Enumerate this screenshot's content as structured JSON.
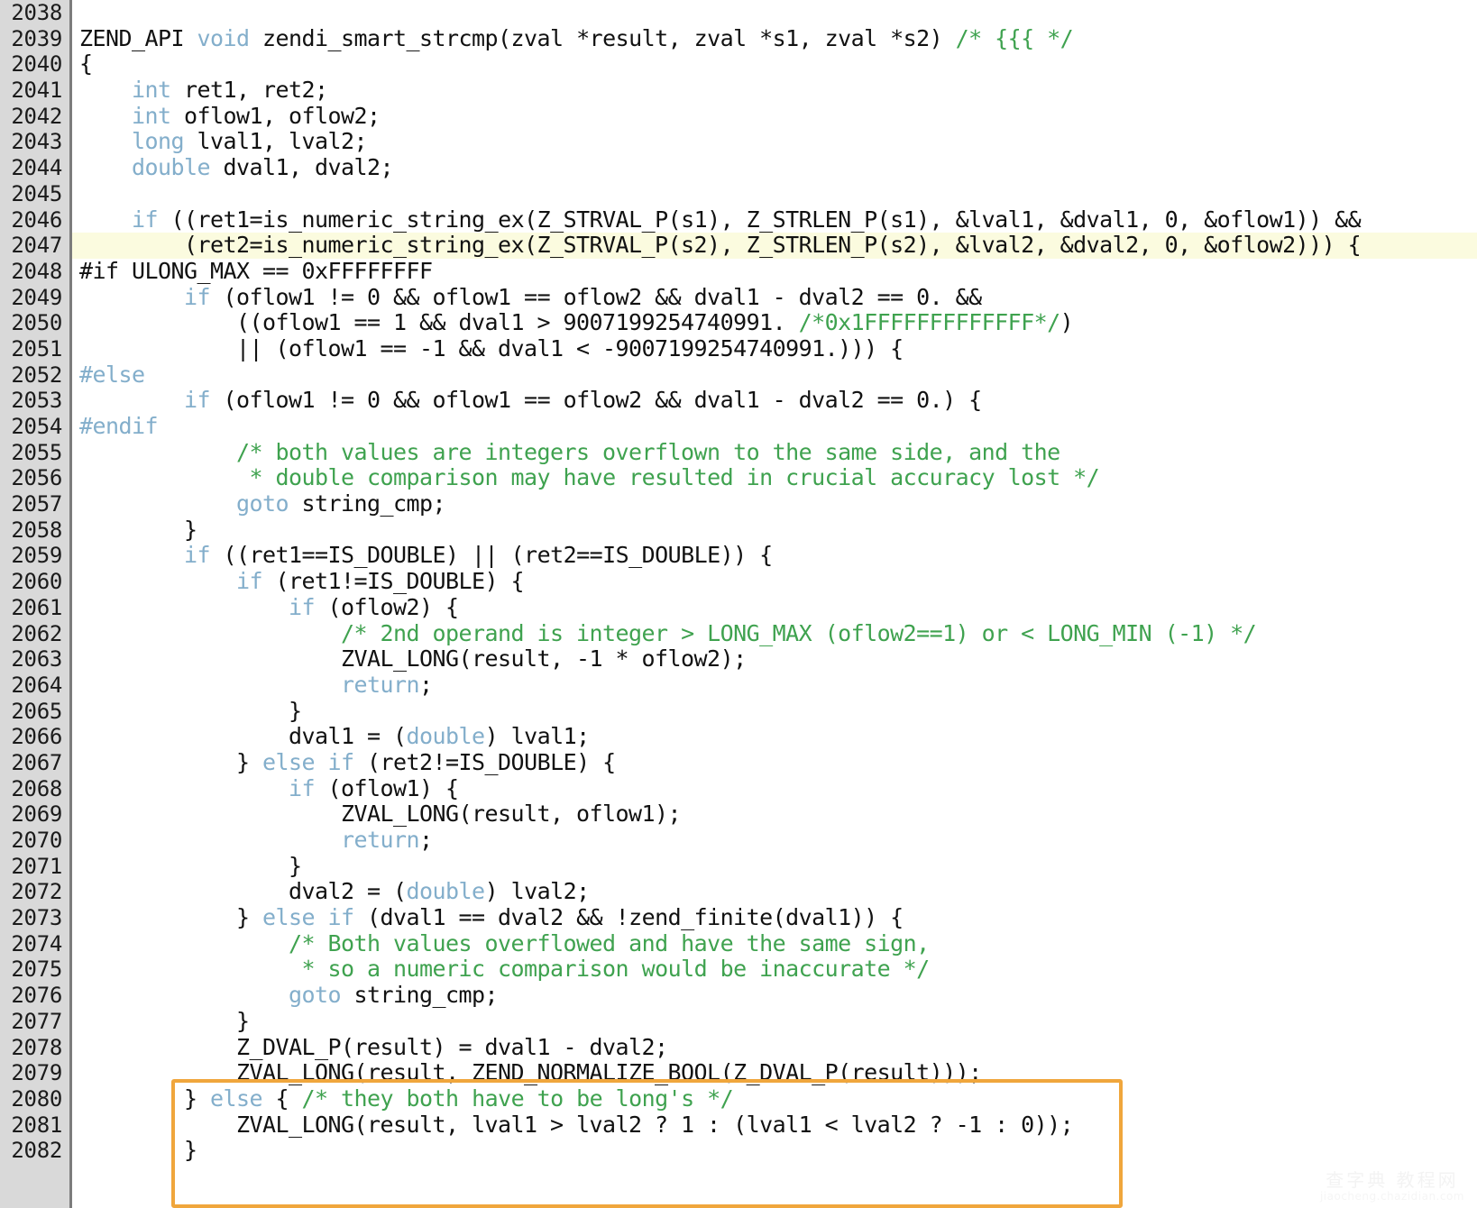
{
  "editor": {
    "title": "zendi_smart_strcmp source listing",
    "language": "C",
    "gutter_start_line": 2038,
    "gutter_end_line": 2082,
    "colors": {
      "background": "#ffffff",
      "gutter": "#d9d9d9",
      "gutter_border": "#7c7c7c",
      "text": "#111111",
      "keyword": "#83aecb",
      "comment": "#3fa24f",
      "highlight_line": "#fbfbdf",
      "callout_box": "#f0a63c"
    },
    "highlighted_line": 2047,
    "callout_box_lines": [
      2080,
      2082
    ]
  },
  "watermark": {
    "main": "查字典 教程网",
    "sub": "jiaocheng.chazidian.com"
  },
  "lines": [
    {
      "n": "2038",
      "hl": false,
      "tokens": []
    },
    {
      "n": "2039",
      "hl": false,
      "tokens": [
        {
          "t": "ZEND_API ",
          "c": "plain"
        },
        {
          "t": "void",
          "c": "kw"
        },
        {
          "t": " zendi_smart_strcmp(zval *result, zval *s1, zval *s2) ",
          "c": "plain"
        },
        {
          "t": "/* {{{ */",
          "c": "cmt"
        }
      ]
    },
    {
      "n": "2040",
      "hl": false,
      "tokens": [
        {
          "t": "{",
          "c": "plain"
        }
      ]
    },
    {
      "n": "2041",
      "hl": false,
      "tokens": [
        {
          "t": "    ",
          "c": "plain"
        },
        {
          "t": "int",
          "c": "kw"
        },
        {
          "t": " ret1, ret2;",
          "c": "plain"
        }
      ]
    },
    {
      "n": "2042",
      "hl": false,
      "tokens": [
        {
          "t": "    ",
          "c": "plain"
        },
        {
          "t": "int",
          "c": "kw"
        },
        {
          "t": " oflow1, oflow2;",
          "c": "plain"
        }
      ]
    },
    {
      "n": "2043",
      "hl": false,
      "tokens": [
        {
          "t": "    ",
          "c": "plain"
        },
        {
          "t": "long",
          "c": "kw"
        },
        {
          "t": " lval1, lval2;",
          "c": "plain"
        }
      ]
    },
    {
      "n": "2044",
      "hl": false,
      "tokens": [
        {
          "t": "    ",
          "c": "plain"
        },
        {
          "t": "double",
          "c": "kw"
        },
        {
          "t": " dval1, dval2;",
          "c": "plain"
        }
      ]
    },
    {
      "n": "2045",
      "hl": false,
      "tokens": []
    },
    {
      "n": "2046",
      "hl": false,
      "tokens": [
        {
          "t": "    ",
          "c": "plain"
        },
        {
          "t": "if",
          "c": "kw"
        },
        {
          "t": " ((ret1=is_numeric_string_ex(Z_STRVAL_P(s1), Z_STRLEN_P(s1), &lval1, &dval1, 0, &oflow1)) &&",
          "c": "plain"
        }
      ]
    },
    {
      "n": "2047",
      "hl": true,
      "tokens": [
        {
          "t": "        (ret2=is_numeric_string_ex(Z_STRVAL_P(s2), Z_STRLEN_P(s2), &lval2, &dval2, 0, &oflow2))) {",
          "c": "plain"
        }
      ]
    },
    {
      "n": "2048",
      "hl": false,
      "tokens": [
        {
          "t": "#if",
          "c": "plain"
        },
        {
          "t": " ULONG_MAX == 0xFFFFFFFF",
          "c": "plain"
        }
      ]
    },
    {
      "n": "2049",
      "hl": false,
      "tokens": [
        {
          "t": "        ",
          "c": "plain"
        },
        {
          "t": "if",
          "c": "kw"
        },
        {
          "t": " (oflow1 != 0 && oflow1 == oflow2 && dval1 - dval2 == 0. &&",
          "c": "plain"
        }
      ]
    },
    {
      "n": "2050",
      "hl": false,
      "tokens": [
        {
          "t": "            ((oflow1 == 1 && dval1 > 9007199254740991. ",
          "c": "plain"
        },
        {
          "t": "/*0x1FFFFFFFFFFFFF*/",
          "c": "cmt"
        },
        {
          "t": ")",
          "c": "plain"
        }
      ]
    },
    {
      "n": "2051",
      "hl": false,
      "tokens": [
        {
          "t": "            || (oflow1 == -1 && dval1 < -9007199254740991.))) {",
          "c": "plain"
        }
      ]
    },
    {
      "n": "2052",
      "hl": false,
      "tokens": [
        {
          "t": "#else",
          "c": "kw"
        }
      ]
    },
    {
      "n": "2053",
      "hl": false,
      "tokens": [
        {
          "t": "        ",
          "c": "plain"
        },
        {
          "t": "if",
          "c": "kw"
        },
        {
          "t": " (oflow1 != 0 && oflow1 == oflow2 && dval1 - dval2 == 0.) {",
          "c": "plain"
        }
      ]
    },
    {
      "n": "2054",
      "hl": false,
      "tokens": [
        {
          "t": "#endif",
          "c": "kw"
        }
      ]
    },
    {
      "n": "2055",
      "hl": false,
      "tokens": [
        {
          "t": "            ",
          "c": "plain"
        },
        {
          "t": "/* both values are integers overflown to the same side, and the",
          "c": "cmt"
        }
      ]
    },
    {
      "n": "2056",
      "hl": false,
      "tokens": [
        {
          "t": "             ",
          "c": "plain"
        },
        {
          "t": "* double comparison may have resulted in crucial accuracy lost */",
          "c": "cmt"
        }
      ]
    },
    {
      "n": "2057",
      "hl": false,
      "tokens": [
        {
          "t": "            ",
          "c": "plain"
        },
        {
          "t": "goto",
          "c": "kw"
        },
        {
          "t": " string_cmp;",
          "c": "plain"
        }
      ]
    },
    {
      "n": "2058",
      "hl": false,
      "tokens": [
        {
          "t": "        }",
          "c": "plain"
        }
      ]
    },
    {
      "n": "2059",
      "hl": false,
      "tokens": [
        {
          "t": "        ",
          "c": "plain"
        },
        {
          "t": "if",
          "c": "kw"
        },
        {
          "t": " ((ret1==IS_DOUBLE) || (ret2==IS_DOUBLE)) {",
          "c": "plain"
        }
      ]
    },
    {
      "n": "2060",
      "hl": false,
      "tokens": [
        {
          "t": "            ",
          "c": "plain"
        },
        {
          "t": "if",
          "c": "kw"
        },
        {
          "t": " (ret1!=IS_DOUBLE) {",
          "c": "plain"
        }
      ]
    },
    {
      "n": "2061",
      "hl": false,
      "tokens": [
        {
          "t": "                ",
          "c": "plain"
        },
        {
          "t": "if",
          "c": "kw"
        },
        {
          "t": " (oflow2) {",
          "c": "plain"
        }
      ]
    },
    {
      "n": "2062",
      "hl": false,
      "tokens": [
        {
          "t": "                    ",
          "c": "plain"
        },
        {
          "t": "/* 2nd operand is integer > LONG_MAX (oflow2==1) or < LONG_MIN (-1) */",
          "c": "cmt"
        }
      ]
    },
    {
      "n": "2063",
      "hl": false,
      "tokens": [
        {
          "t": "                    ZVAL_LONG(result, -1 * oflow2);",
          "c": "plain"
        }
      ]
    },
    {
      "n": "2064",
      "hl": false,
      "tokens": [
        {
          "t": "                    ",
          "c": "plain"
        },
        {
          "t": "return",
          "c": "kw"
        },
        {
          "t": ";",
          "c": "plain"
        }
      ]
    },
    {
      "n": "2065",
      "hl": false,
      "tokens": [
        {
          "t": "                }",
          "c": "plain"
        }
      ]
    },
    {
      "n": "2066",
      "hl": false,
      "tokens": [
        {
          "t": "                dval1 = (",
          "c": "plain"
        },
        {
          "t": "double",
          "c": "kw"
        },
        {
          "t": ") lval1;",
          "c": "plain"
        }
      ]
    },
    {
      "n": "2067",
      "hl": false,
      "tokens": [
        {
          "t": "            } ",
          "c": "plain"
        },
        {
          "t": "else if",
          "c": "kw"
        },
        {
          "t": " (ret2!=IS_DOUBLE) {",
          "c": "plain"
        }
      ]
    },
    {
      "n": "2068",
      "hl": false,
      "tokens": [
        {
          "t": "                ",
          "c": "plain"
        },
        {
          "t": "if",
          "c": "kw"
        },
        {
          "t": " (oflow1) {",
          "c": "plain"
        }
      ]
    },
    {
      "n": "2069",
      "hl": false,
      "tokens": [
        {
          "t": "                    ZVAL_LONG(result, oflow1);",
          "c": "plain"
        }
      ]
    },
    {
      "n": "2070",
      "hl": false,
      "tokens": [
        {
          "t": "                    ",
          "c": "plain"
        },
        {
          "t": "return",
          "c": "kw"
        },
        {
          "t": ";",
          "c": "plain"
        }
      ]
    },
    {
      "n": "2071",
      "hl": false,
      "tokens": [
        {
          "t": "                }",
          "c": "plain"
        }
      ]
    },
    {
      "n": "2072",
      "hl": false,
      "tokens": [
        {
          "t": "                dval2 = (",
          "c": "plain"
        },
        {
          "t": "double",
          "c": "kw"
        },
        {
          "t": ") lval2;",
          "c": "plain"
        }
      ]
    },
    {
      "n": "2073",
      "hl": false,
      "tokens": [
        {
          "t": "            } ",
          "c": "plain"
        },
        {
          "t": "else if",
          "c": "kw"
        },
        {
          "t": " (dval1 == dval2 && !zend_finite(dval1)) {",
          "c": "plain"
        }
      ]
    },
    {
      "n": "2074",
      "hl": false,
      "tokens": [
        {
          "t": "                ",
          "c": "plain"
        },
        {
          "t": "/* Both values overflowed and have the same sign,",
          "c": "cmt"
        }
      ]
    },
    {
      "n": "2075",
      "hl": false,
      "tokens": [
        {
          "t": "                 ",
          "c": "plain"
        },
        {
          "t": "* so a numeric comparison would be inaccurate */",
          "c": "cmt"
        }
      ]
    },
    {
      "n": "2076",
      "hl": false,
      "tokens": [
        {
          "t": "                ",
          "c": "plain"
        },
        {
          "t": "goto",
          "c": "kw"
        },
        {
          "t": " string_cmp;",
          "c": "plain"
        }
      ]
    },
    {
      "n": "2077",
      "hl": false,
      "tokens": [
        {
          "t": "            }",
          "c": "plain"
        }
      ]
    },
    {
      "n": "2078",
      "hl": false,
      "tokens": [
        {
          "t": "            Z_DVAL_P(result) = dval1 - dval2;",
          "c": "plain"
        }
      ]
    },
    {
      "n": "2079",
      "hl": false,
      "tokens": [
        {
          "t": "            ZVAL_LONG(result, ZEND_NORMALIZE_BOOL(Z_DVAL_P(result)));",
          "c": "plain"
        }
      ]
    },
    {
      "n": "2080",
      "hl": false,
      "tokens": [
        {
          "t": "        } ",
          "c": "plain"
        },
        {
          "t": "else",
          "c": "kw"
        },
        {
          "t": " { ",
          "c": "plain"
        },
        {
          "t": "/* they both have to be long's */",
          "c": "cmt"
        }
      ]
    },
    {
      "n": "2081",
      "hl": false,
      "tokens": [
        {
          "t": "            ZVAL_LONG(result, lval1 > lval2 ? 1 : (lval1 < lval2 ? -1 : 0));",
          "c": "plain"
        }
      ]
    },
    {
      "n": "2082",
      "hl": false,
      "tokens": [
        {
          "t": "        }",
          "c": "plain"
        }
      ]
    }
  ]
}
